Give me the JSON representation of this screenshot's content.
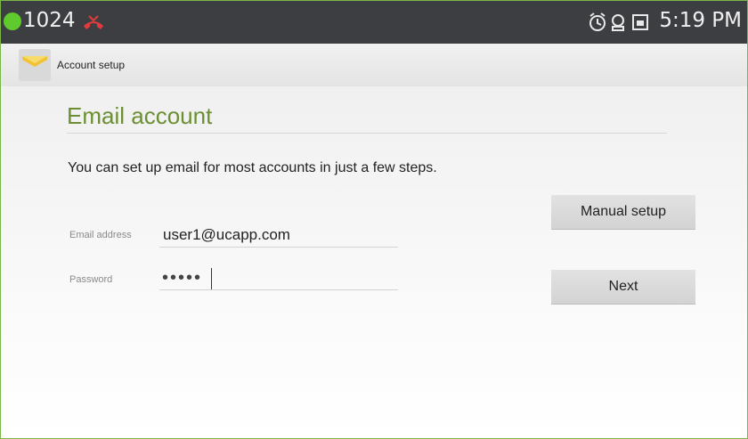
{
  "status_bar": {
    "notification_count": "1024",
    "time": "5:19 PM",
    "icons": [
      "green-dot-icon",
      "missed-call-icon",
      "alarm-icon",
      "cloud-icon",
      "screen-icon"
    ]
  },
  "action_bar": {
    "title": "Account setup",
    "icon": "email-app-icon"
  },
  "content": {
    "section_title": "Email account",
    "intro": "You can set up email for most accounts in just a few steps.",
    "email_label": "Email address",
    "email_value": "user1@ucapp.com",
    "password_label": "Password",
    "password_value": "•••••"
  },
  "buttons": {
    "manual_setup": "Manual setup",
    "next": "Next"
  },
  "colors": {
    "accent_green": "#6b8f32",
    "status_bar": "#3d3e42",
    "status_dot": "#5fc92e"
  }
}
